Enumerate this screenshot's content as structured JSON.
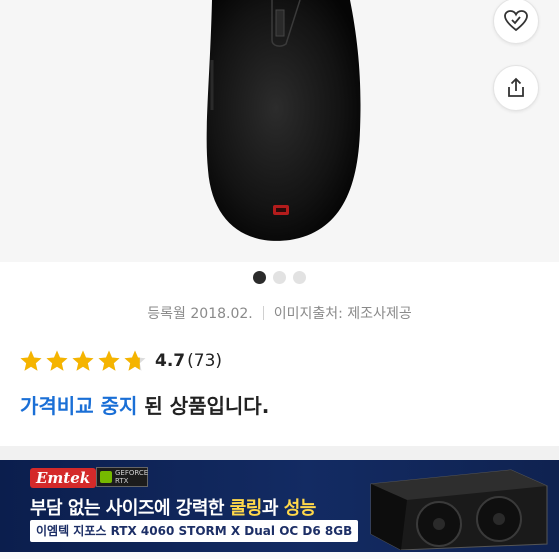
{
  "product": {
    "image_alt": "black gaming mouse",
    "brand_mark": "zowie-logo"
  },
  "actions": {
    "wishlist_icon": "heart-check-icon",
    "share_icon": "share-icon"
  },
  "carousel": {
    "total": 3,
    "active_index": 0
  },
  "meta": {
    "registered": "등록월 2018.02.",
    "image_source": "이미지출처: 제조사제공"
  },
  "rating": {
    "score": "4.7",
    "count": "(73)",
    "stars_filled": 4.7,
    "star_color": "#f5b400"
  },
  "status": {
    "highlight": "가격비교 중지",
    "rest": " 된 상품입니다.",
    "highlight_color": "#1a6fd6"
  },
  "banner": {
    "logo": "Emtek",
    "badge": "GEFORCE RTX",
    "headline_prefix": "부담 없는 사이즈에 강력한 ",
    "headline_hl1": "쿨링",
    "headline_mid": "과 ",
    "headline_hl2": "성능",
    "subline": "이엠텍 지포스 RTX 4060 STORM X Dual OC D6 8GB",
    "bg_color": "#0b1e4d"
  }
}
